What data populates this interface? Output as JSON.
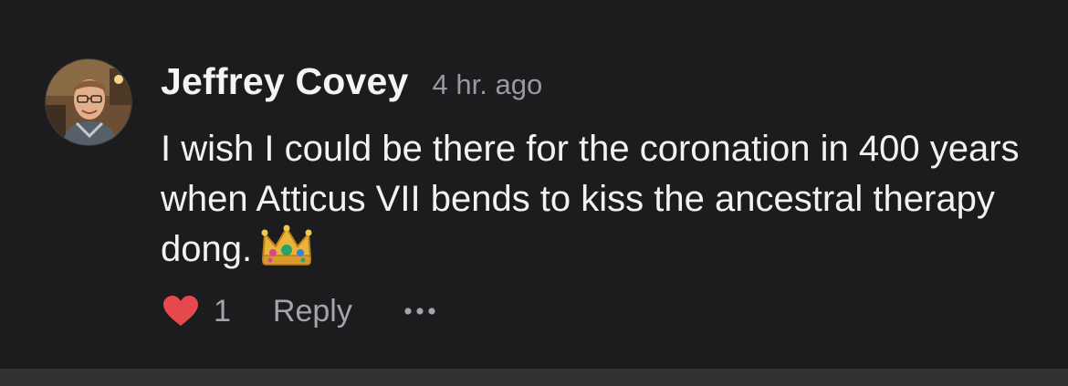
{
  "comment": {
    "author": "Jeffrey Covey",
    "time": "4 hr. ago",
    "text": "I wish I could be there for the coronation in 400 years when Atticus VII bends to kiss the ancestral therapy dong.",
    "emoji_icon": "crown-icon",
    "likes": "1",
    "reply_label": "Reply",
    "more_icon": "ellipsis-icon",
    "heart_icon": "heart-icon",
    "avatar_icon": "avatar"
  },
  "colors": {
    "background": "#1c1b1d",
    "heart": "#e5484d",
    "text": "#f2f2f3",
    "muted": "#9a999e"
  }
}
